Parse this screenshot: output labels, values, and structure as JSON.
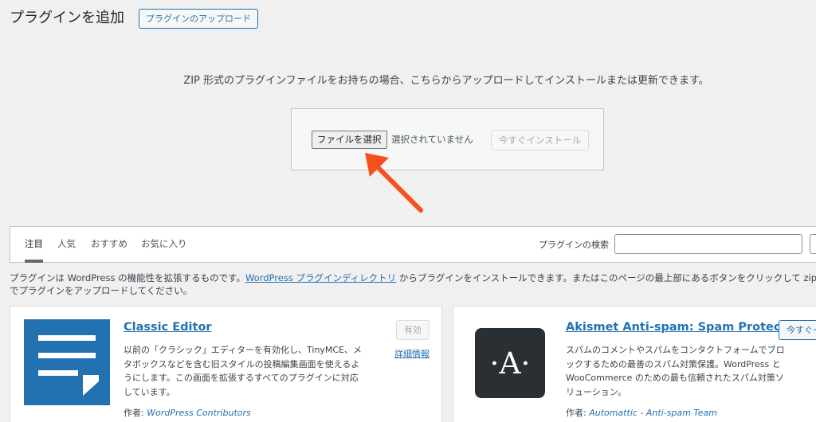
{
  "header": {
    "title": "プラグインを追加",
    "upload_toggle_label": "プラグインのアップロード"
  },
  "upload": {
    "help_text": "ZIP 形式のプラグインファイルをお持ちの場合、こちらからアップロードしてインストールまたは更新できます。",
    "file_button_label": "ファイルを選択",
    "file_status": "選択されていません",
    "install_button_label": "今すぐインストール"
  },
  "annotation": {
    "arrow_color": "#f4511e"
  },
  "filters": {
    "tabs": [
      {
        "label": "注目",
        "active": true
      },
      {
        "label": "人気",
        "active": false
      },
      {
        "label": "おすすめ",
        "active": false
      },
      {
        "label": "お気に入り",
        "active": false
      }
    ],
    "search_label": "プラグインの検索"
  },
  "intro": {
    "before_link": "プラグインは WordPress の機能性を拡張するものです。",
    "link": "WordPress プラグインディレクトリ",
    "after_link": " からプラグインをインストールできます。またはこのページの最上部にあるボタンをクリックして zip 形式でプラグインをアップロードしてください。"
  },
  "cards": [
    {
      "name": "Classic Editor",
      "description": "以前の「クラシック」エディターを有効化し、TinyMCE、メタボックスなどを含む旧スタイルの投稿編集画面を使えるようにします。この画面を拡張するすべてのプラグインに対応しています。",
      "author_label": "作者:",
      "author": "WordPress Contributors",
      "action_label": "有効",
      "more_label": "詳細情報",
      "icon": "classic-editor-icon",
      "icon_bg": "#2271b1"
    },
    {
      "name": "Akismet Anti-spam: Spam Protection",
      "description": "スパムのコメントやスパムをコンタクトフォームでブロックするための最善のスパム対策保護。WordPress と WooCommerce のための最も信頼されたスパム対策ソリューション。",
      "author_label": "作者:",
      "author": "Automattic - Anti-spam Team",
      "action_label": "今すぐインストール",
      "icon": "akismet-icon",
      "icon_glyph": "·A·",
      "icon_bg": "#2a2f33"
    }
  ],
  "colors": {
    "accent": "#2271b1",
    "page_bg": "#f0f0f1"
  }
}
